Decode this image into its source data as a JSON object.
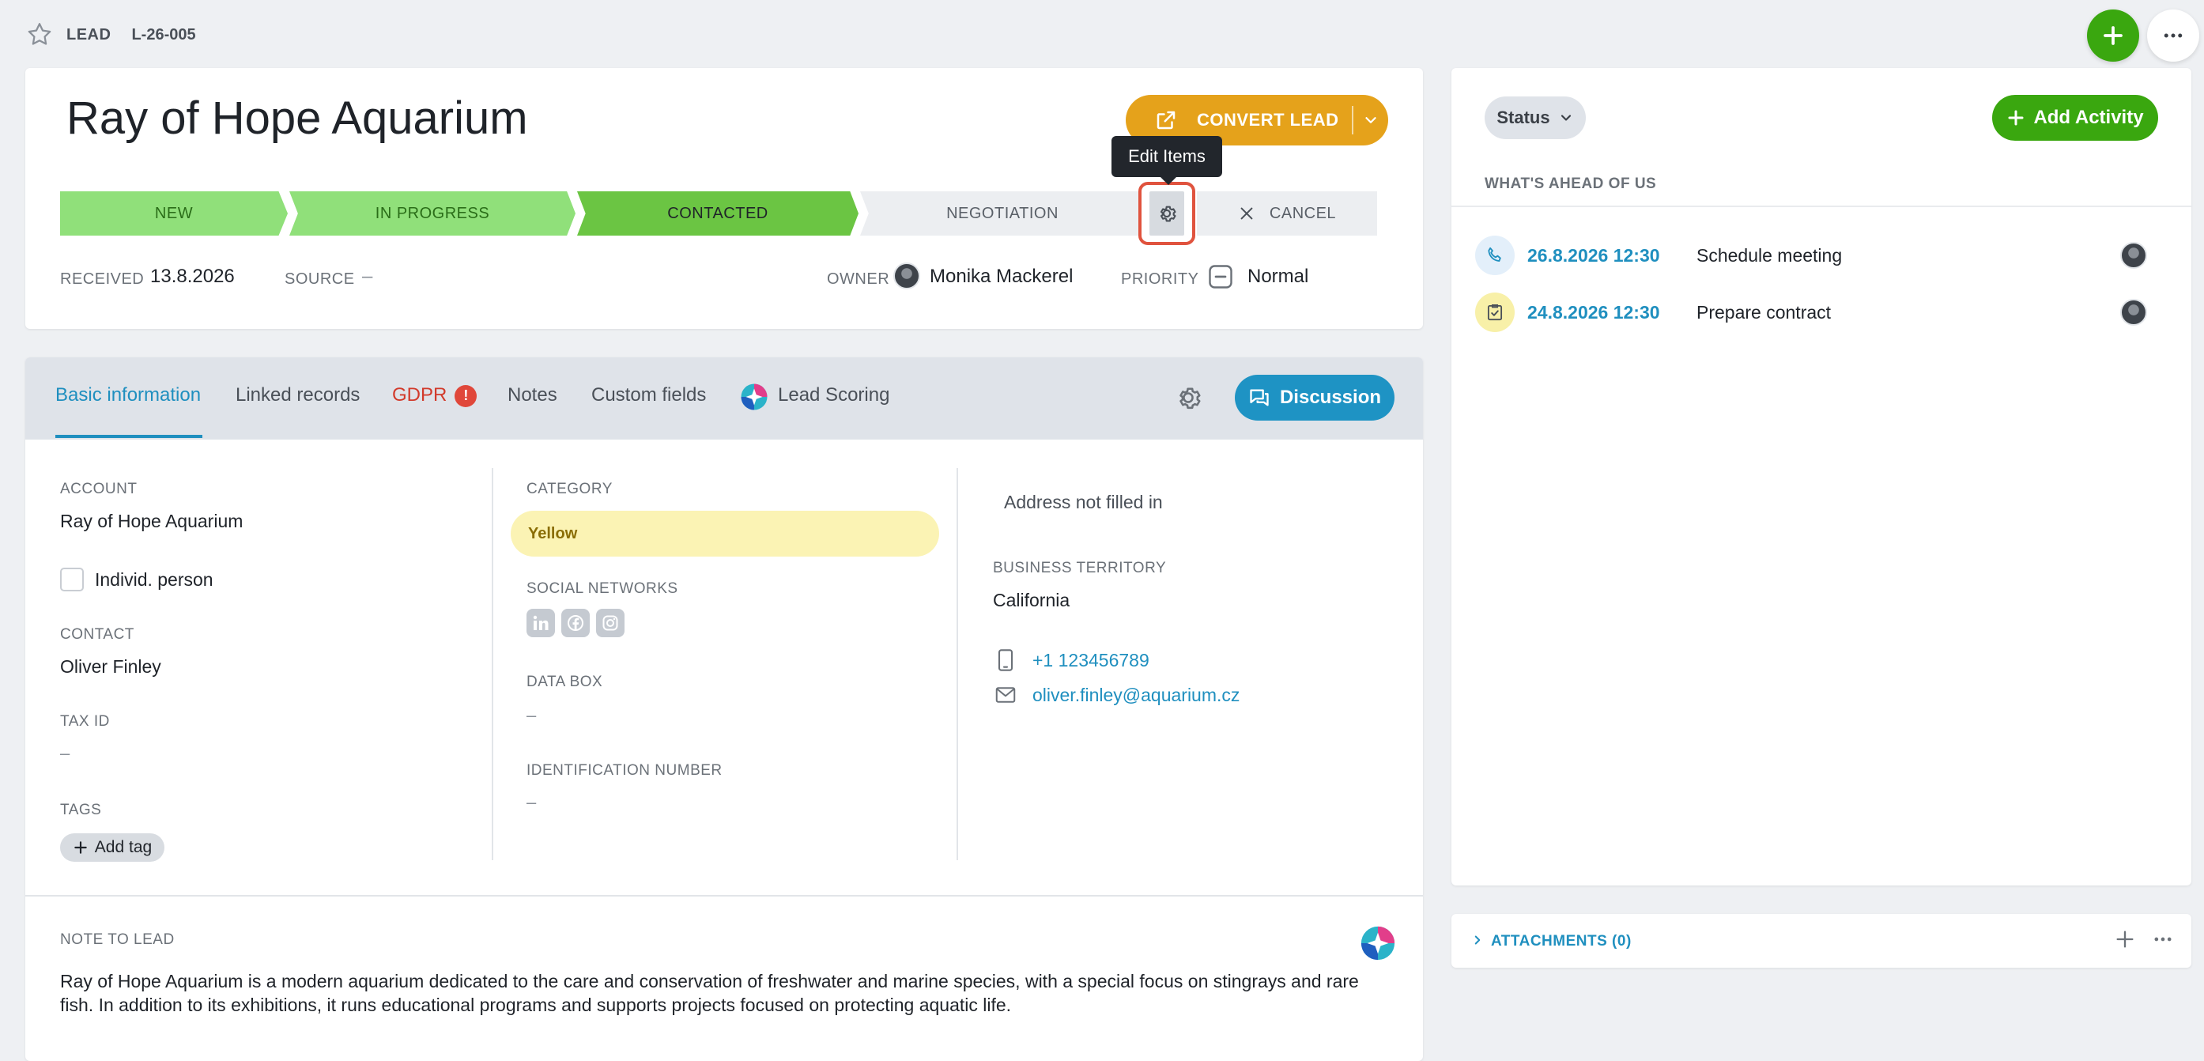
{
  "header": {
    "entity_type": "LEAD",
    "entity_code": "L-26-005",
    "title": "Ray of Hope Aquarium",
    "convert_label": "CONVERT LEAD",
    "tooltip": "Edit Items"
  },
  "pipeline": {
    "stages": [
      "NEW",
      "IN PROGRESS",
      "CONTACTED",
      "NEGOTIATION"
    ],
    "current": "CONTACTED",
    "cancel_label": "CANCEL"
  },
  "meta": {
    "received_label": "RECEIVED",
    "received_value": "13.8.2026",
    "source_label": "SOURCE",
    "source_value": "–",
    "owner_label": "OWNER",
    "owner_value": "Monika Mackerel",
    "priority_label": "PRIORITY",
    "priority_value": "Normal"
  },
  "tabs": {
    "items": [
      "Basic information",
      "Linked records",
      "GDPR",
      "Notes",
      "Custom fields",
      "Lead Scoring"
    ],
    "active": "Basic information",
    "gdpr_badge": "!",
    "discussion_label": "Discussion"
  },
  "col1": {
    "account_label": "ACCOUNT",
    "account_value": "Ray of Hope Aquarium",
    "individ_label": "Individ. person",
    "individ_checked": false,
    "contact_label": "CONTACT",
    "contact_value": "Oliver Finley",
    "taxid_label": "TAX ID",
    "taxid_value": "–",
    "tags_label": "TAGS",
    "add_tag_label": "Add tag"
  },
  "col2": {
    "category_label": "CATEGORY",
    "category_value": "Yellow",
    "social_label": "SOCIAL NETWORKS",
    "social_icons": [
      "linkedin-icon",
      "facebook-icon",
      "instagram-icon"
    ],
    "databox_label": "DATA BOX",
    "databox_value": "–",
    "idnum_label": "IDENTIFICATION NUMBER",
    "idnum_value": "–"
  },
  "col3": {
    "address_value": "Address not filled in",
    "territory_label": "BUSINESS TERRITORY",
    "territory_value": "California",
    "phone": "+1 123456789",
    "email": "oliver.finley@aquarium.cz"
  },
  "note": {
    "label": "NOTE TO LEAD",
    "text": "Ray of Hope Aquarium is a modern aquarium dedicated to the care and conservation of freshwater and marine species, with a special focus on stingrays and rare fish. In addition to its exhibitions, it runs educational programs and supports projects focused on protecting aquatic life."
  },
  "side": {
    "status_label": "Status",
    "add_activity_label": "Add Activity",
    "ahead_label": "WHAT'S AHEAD OF US",
    "activities": [
      {
        "date": "26.8.2026 12:30",
        "title": "Schedule meeting",
        "icon": "phone-icon"
      },
      {
        "date": "24.8.2026 12:30",
        "title": "Prepare contract",
        "icon": "task-check-icon"
      }
    ],
    "attachments_label": "ATTACHMENTS (0)"
  },
  "colors": {
    "accent_blue": "#1f8fbf",
    "brand_green": "#3aa70f",
    "convert_orange": "#e5a21b",
    "stage_done": "#90e07a",
    "stage_current": "#6bc543",
    "alert_red": "#e0473a"
  }
}
